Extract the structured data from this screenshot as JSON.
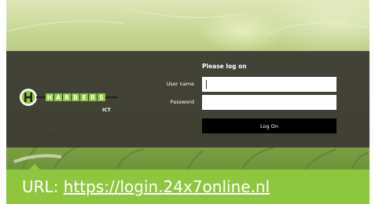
{
  "login": {
    "title": "Please log on",
    "username_label": "User name",
    "username_value": "",
    "password_label": "Password",
    "password_value": "",
    "submit_label": "Log On"
  },
  "logo": {
    "letters": [
      "H",
      "A",
      "R",
      "B",
      "E",
      "R",
      "S"
    ],
    "subtitle": "ICT",
    "brand_color": "#8fc63f"
  },
  "banner": {
    "prefix": "URL: ",
    "url": "https://login.24x7online.nl",
    "color": "#8fc63f"
  }
}
